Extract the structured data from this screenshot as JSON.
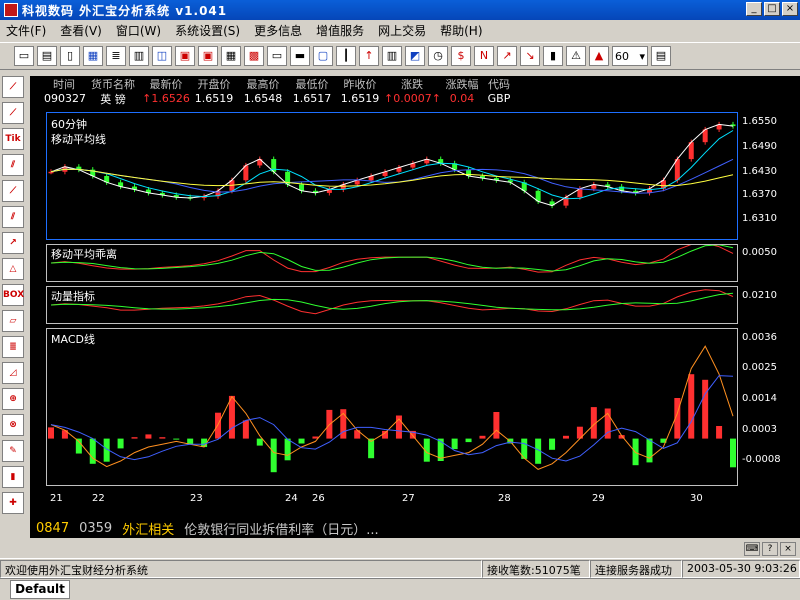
{
  "window": {
    "title": "科视数码 外汇宝分析系统 v1.041"
  },
  "menu": [
    "文件(F)",
    "查看(V)",
    "窗口(W)",
    "系统设置(S)",
    "更多信息",
    "增值服务",
    "网上交易",
    "帮助(H)"
  ],
  "toolbar": {
    "period_value": "60"
  },
  "quote": {
    "headers": [
      "时间",
      "货币名称",
      "最新价",
      "开盘价",
      "最高价",
      "最低价",
      "昨收价",
      "涨跌",
      "涨跌幅",
      "代码"
    ],
    "values": [
      "090327",
      "英  镑",
      "↑1.6526",
      "1.6519",
      "1.6548",
      "1.6517",
      "1.6519",
      "↑0.0007↑",
      "0.04",
      "GBP"
    ]
  },
  "panels": {
    "main": {
      "label1": "60分钟",
      "label2": "移动平均线",
      "yticks": [
        "1.6550",
        "1.6490",
        "1.6430",
        "1.6370",
        "1.6310"
      ]
    },
    "bias": {
      "label": "移动平均乖离",
      "yticks": [
        "0.0050"
      ]
    },
    "momentum": {
      "label": "动量指标",
      "yticks": [
        "0.0210"
      ]
    },
    "macd": {
      "label": "MACD线",
      "yticks": [
        "0.0036",
        "0.0025",
        "0.0014",
        "0.0003",
        "-0.0008"
      ]
    }
  },
  "dates": [
    "21",
    "22",
    "23",
    "24",
    "26",
    "27",
    "28",
    "29",
    "30"
  ],
  "ticker": {
    "code1": "0847",
    "code2": "0359",
    "category": "外汇相关",
    "headline": "伦敦银行同业拆借利率（日元）..."
  },
  "status": {
    "welcome": "欢迎使用外汇宝财经分析系统",
    "count": "接收笔数:51075笔",
    "connection": "连接服务器成功",
    "datetime": "2003-05-30  9:03:26"
  },
  "tab": {
    "label": "Default"
  },
  "chart_data": {
    "type": "candlestick-with-indicators",
    "series": [
      {
        "name": "移动平均线",
        "values": [
          1.644,
          1.6452,
          1.6445,
          1.643,
          1.6415,
          1.6405,
          1.6398,
          1.639,
          1.6385,
          1.638,
          1.6378,
          1.6382,
          1.6395,
          1.642,
          1.6455,
          1.647,
          1.644,
          1.641,
          1.6395,
          1.639,
          1.6398,
          1.641,
          1.642,
          1.643,
          1.644,
          1.645,
          1.646,
          1.647,
          1.646,
          1.6445,
          1.643,
          1.6425,
          1.642,
          1.6415,
          1.6395,
          1.637,
          1.636,
          1.638,
          1.64,
          1.641,
          1.6405,
          1.6395,
          1.639,
          1.64,
          1.642,
          1.647,
          1.651,
          1.654,
          1.6552,
          1.6548
        ]
      },
      {
        "name": "MACD线",
        "values": [
          0.0008,
          0.0006,
          0.0002,
          -0.0004,
          -0.0007,
          -0.0005,
          -0.0002,
          0.0,
          0.0001,
          0.0002,
          0.0001,
          0.0,
          0.0008,
          0.0018,
          0.0012,
          0.0004,
          -0.0002,
          -0.0003,
          0.0,
          0.0002,
          0.0008,
          0.0012,
          0.0006,
          0.0002,
          0.0005,
          0.001,
          0.0004,
          -0.0002,
          -0.0004,
          -0.0003,
          -0.0002,
          0.0001,
          0.0006,
          0.0002,
          -0.0004,
          -0.0008,
          -0.0006,
          -0.0002,
          0.0003,
          0.0008,
          0.0012,
          0.0004,
          -0.0002,
          -0.0004,
          0.0,
          0.0012,
          0.0028,
          0.0036,
          0.0026,
          0.0011
        ]
      }
    ],
    "x": [
      "21",
      "22",
      "23",
      "24",
      "26",
      "27",
      "28",
      "29",
      "30"
    ],
    "ylim_main": [
      1.63,
      1.656
    ],
    "ylim_macd": [
      -0.001,
      0.004
    ]
  }
}
